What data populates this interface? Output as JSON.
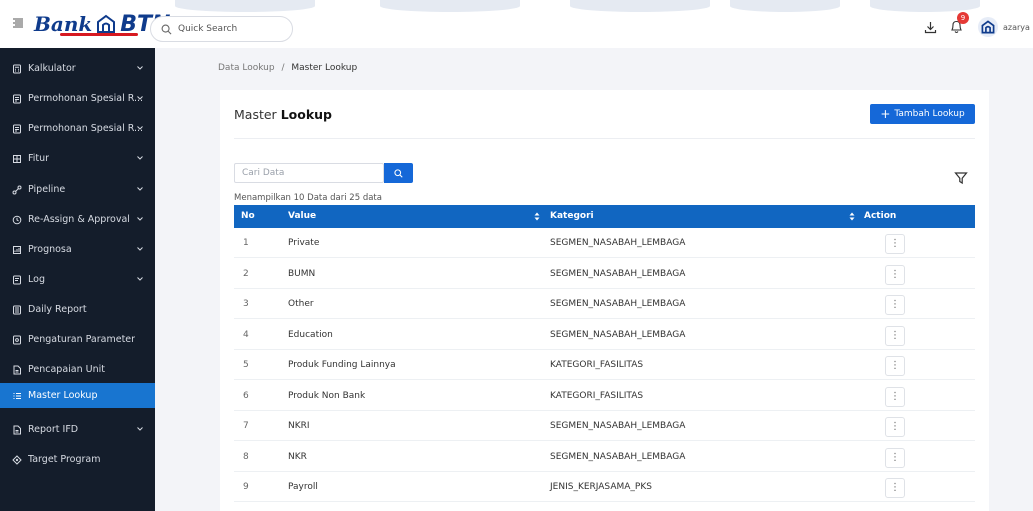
{
  "header": {
    "logo_word": "Bank",
    "logo_brand": "BTN",
    "search_placeholder": "Quick Search",
    "notification_count": "9",
    "username": "azarya"
  },
  "sidebar": {
    "items": [
      {
        "label": "Kalkulator",
        "icon": "calculator-icon",
        "chevron": true,
        "active": false
      },
      {
        "label": "Permohonan Spesial R...",
        "icon": "document-icon",
        "chevron": true,
        "active": false
      },
      {
        "label": "Permohonan Spesial R...",
        "icon": "document-icon",
        "chevron": true,
        "active": false
      },
      {
        "label": "Fitur",
        "icon": "grid-icon",
        "chevron": true,
        "active": false
      },
      {
        "label": "Pipeline",
        "icon": "pipeline-icon",
        "chevron": true,
        "active": false
      },
      {
        "label": "Re-Assign & Approval",
        "icon": "clock-icon",
        "chevron": true,
        "active": false
      },
      {
        "label": "Prognosa",
        "icon": "chart-icon",
        "chevron": true,
        "active": false
      },
      {
        "label": "Log",
        "icon": "log-icon",
        "chevron": true,
        "active": false
      },
      {
        "label": "Daily Report",
        "icon": "report-icon",
        "chevron": false,
        "active": false
      },
      {
        "label": "Pengaturan Parameter",
        "icon": "settings-doc-icon",
        "chevron": false,
        "active": false
      },
      {
        "label": "Pencapaian Unit",
        "icon": "file-icon",
        "chevron": false,
        "active": false
      },
      {
        "label": "Master Lookup",
        "icon": "list-icon",
        "chevron": false,
        "active": true
      },
      {
        "label": "Report IFD",
        "icon": "file-icon",
        "chevron": true,
        "active": false
      },
      {
        "label": "Target Program",
        "icon": "target-icon",
        "chevron": false,
        "active": false
      }
    ]
  },
  "breadcrumb": {
    "parent": "Data Lookup",
    "separator": "/",
    "current": "Master Lookup"
  },
  "page": {
    "title_light": "Master",
    "title_bold": "Lookup",
    "add_button": "Tambah Lookup",
    "search_placeholder": "Cari Data",
    "showing_text": "Menampilkan 10 Data dari 25 data"
  },
  "table": {
    "columns": [
      "No",
      "Value",
      "Kategori",
      "Action"
    ],
    "rows": [
      {
        "no": "1",
        "value": "Private",
        "kategori": "SEGMEN_NASABAH_LEMBAGA"
      },
      {
        "no": "2",
        "value": "BUMN",
        "kategori": "SEGMEN_NASABAH_LEMBAGA"
      },
      {
        "no": "3",
        "value": "Other",
        "kategori": "SEGMEN_NASABAH_LEMBAGA"
      },
      {
        "no": "4",
        "value": "Education",
        "kategori": "SEGMEN_NASABAH_LEMBAGA"
      },
      {
        "no": "5",
        "value": "Produk Funding Lainnya",
        "kategori": "KATEGORI_FASILITAS"
      },
      {
        "no": "6",
        "value": "Produk Non Bank",
        "kategori": "KATEGORI_FASILITAS"
      },
      {
        "no": "7",
        "value": "NKRI",
        "kategori": "SEGMEN_NASABAH_LEMBAGA"
      },
      {
        "no": "8",
        "value": "NKR",
        "kategori": "SEGMEN_NASABAH_LEMBAGA"
      },
      {
        "no": "9",
        "value": "Payroll",
        "kategori": "JENIS_KERJASAMA_PKS"
      }
    ]
  },
  "colors": {
    "primary": "#1568d8",
    "table_header": "#1166c1",
    "sidebar_bg": "#141d2b",
    "sidebar_active": "#1875d0",
    "brand_navy": "#0f3b8c",
    "brand_red": "#d71920",
    "badge": "#e53935"
  }
}
